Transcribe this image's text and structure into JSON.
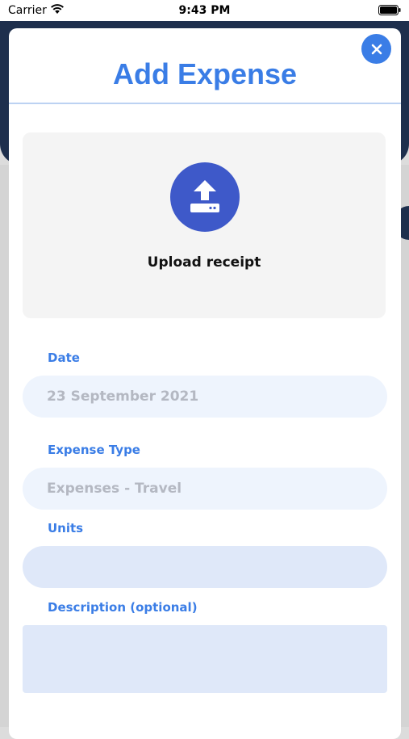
{
  "status_bar": {
    "carrier": "Carrier",
    "time": "9:43 PM"
  },
  "modal": {
    "title": "Add Expense",
    "close_icon": "close-icon"
  },
  "upload": {
    "label": "Upload receipt",
    "icon": "upload-icon"
  },
  "form": {
    "date": {
      "label": "Date",
      "value": "23 September 2021"
    },
    "expense_type": {
      "label": "Expense Type",
      "value": "Expenses - Travel"
    },
    "units": {
      "label": "Units",
      "value": ""
    },
    "description": {
      "label": "Description (optional)",
      "value": ""
    }
  },
  "colors": {
    "accent": "#3a7de6",
    "upload_circle": "#3e59c9",
    "header_navy": "#1e2f4d",
    "field_light": "#eef4fd",
    "field_active": "#dfe8f9"
  }
}
